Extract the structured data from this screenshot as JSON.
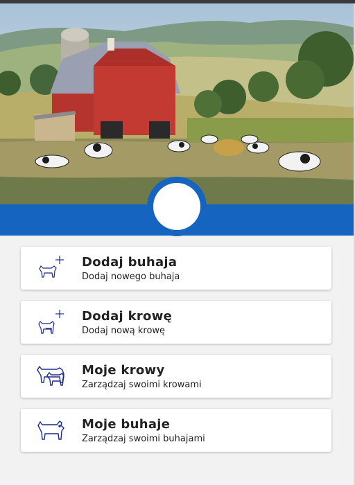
{
  "menu": [
    {
      "title": "Dodaj buhaja",
      "subtitle": "Dodaj nowego buhaja",
      "icon": "add-bull-icon"
    },
    {
      "title": "Dodaj krowę",
      "subtitle": "Dodaj nową krowę",
      "icon": "add-cow-icon"
    },
    {
      "title": "Moje krowy",
      "subtitle": "Zarządzaj swoimi krowami",
      "icon": "cows-icon"
    },
    {
      "title": "Moje buhaje",
      "subtitle": "Zarządzaj swoimi buhajami",
      "icon": "bull-icon"
    }
  ],
  "colors": {
    "accent": "#1565c0",
    "icon": "#1a2a8a"
  }
}
